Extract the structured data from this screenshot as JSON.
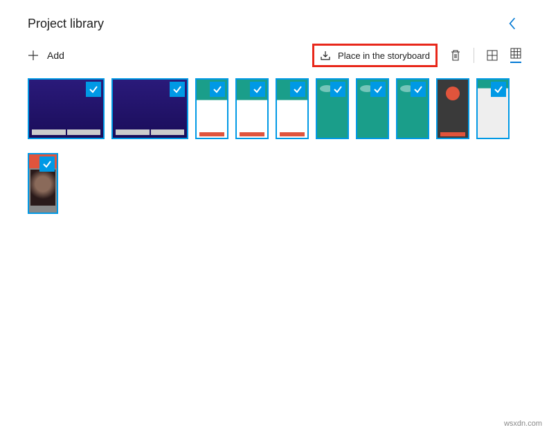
{
  "header": {
    "title": "Project library"
  },
  "toolbar": {
    "add_label": "Add",
    "place_label": "Place in the storyboard"
  },
  "thumbnails": {
    "row1": [
      {
        "idx": 0,
        "cls": "wide bg-purple",
        "selected": true
      },
      {
        "idx": 1,
        "cls": "wide bg-purple",
        "selected": true
      },
      {
        "idx": 2,
        "cls": "tall bg-teal-white",
        "selected": true
      },
      {
        "idx": 3,
        "cls": "tall bg-teal-white",
        "selected": true
      },
      {
        "idx": 4,
        "cls": "tall bg-teal-white",
        "selected": true
      },
      {
        "idx": 5,
        "cls": "tall bg-teal",
        "selected": true
      },
      {
        "idx": 6,
        "cls": "tall bg-teal",
        "selected": true
      },
      {
        "idx": 7,
        "cls": "tall bg-teal",
        "selected": true
      },
      {
        "idx": 8,
        "cls": "tall bg-dark",
        "selected": false
      },
      {
        "idx": 9,
        "cls": "tall bg-teal-light",
        "selected": true
      }
    ],
    "row2": [
      {
        "idx": 10,
        "selected": true
      }
    ]
  },
  "watermark": "wsxdn.com"
}
